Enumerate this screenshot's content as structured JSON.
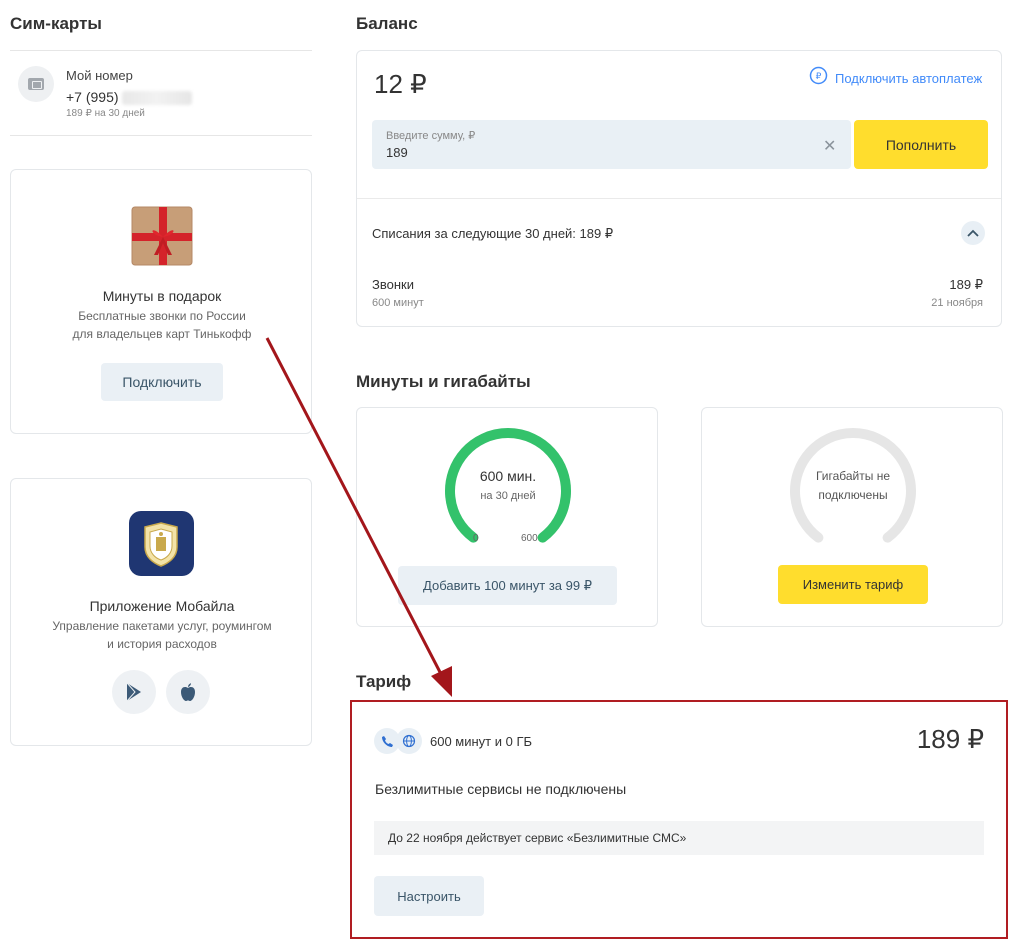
{
  "sim": {
    "title": "Сим-карты",
    "item": {
      "label": "Мой номер",
      "number": "+7 (995)",
      "price": "189 ₽ на 30 дней"
    }
  },
  "promo": {
    "title": "Минуты в подарок",
    "desc_line1": "Бесплатные звонки по России",
    "desc_line2": "для владельцев карт Тинькофф",
    "button": "Подключить"
  },
  "app": {
    "title": "Приложение Мобайла",
    "desc_line1": "Управление пакетами услуг, роумингом",
    "desc_line2": "и история расходов",
    "stores": [
      "google-play-icon",
      "apple-icon"
    ]
  },
  "balance": {
    "heading": "Баланс",
    "amount": "12 ₽",
    "autopay": "Подключить автоплатеж",
    "input_label": "Введите сумму, ₽",
    "input_value": "189",
    "topup_button": "Пополнить",
    "charges_title": "Списания за следующие 30 дней: 189 ₽",
    "charge": {
      "name": "Звонки",
      "detail": "600 минут",
      "amount": "189 ₽",
      "date": "21 ноября"
    }
  },
  "packages": {
    "heading": "Минуты и гигабайты",
    "minutes": {
      "value": "600 мин.",
      "period": "на 30 дней",
      "min": "0",
      "max": "600",
      "fill_fraction": 1.0,
      "button": "Добавить 100 минут за 99 ₽"
    },
    "gigabytes": {
      "line1": "Гигабайты не",
      "line2": "подключены",
      "fill_fraction": 0,
      "button": "Изменить тариф"
    }
  },
  "tariff": {
    "heading": "Тариф",
    "name": "600 минут и 0 ГБ",
    "price": "189 ₽",
    "unlimited": "Безлимитные сервисы не подключены",
    "notice": "До 22 ноября действует сервис «Безлимитные СМС»",
    "button": "Настроить"
  },
  "colors": {
    "accent_yellow": "#ffdd2d",
    "gauge_green": "#33c26b",
    "gauge_grey": "#e6e6e6",
    "annotation_red": "#a3161b",
    "link_blue": "#428bf9"
  }
}
